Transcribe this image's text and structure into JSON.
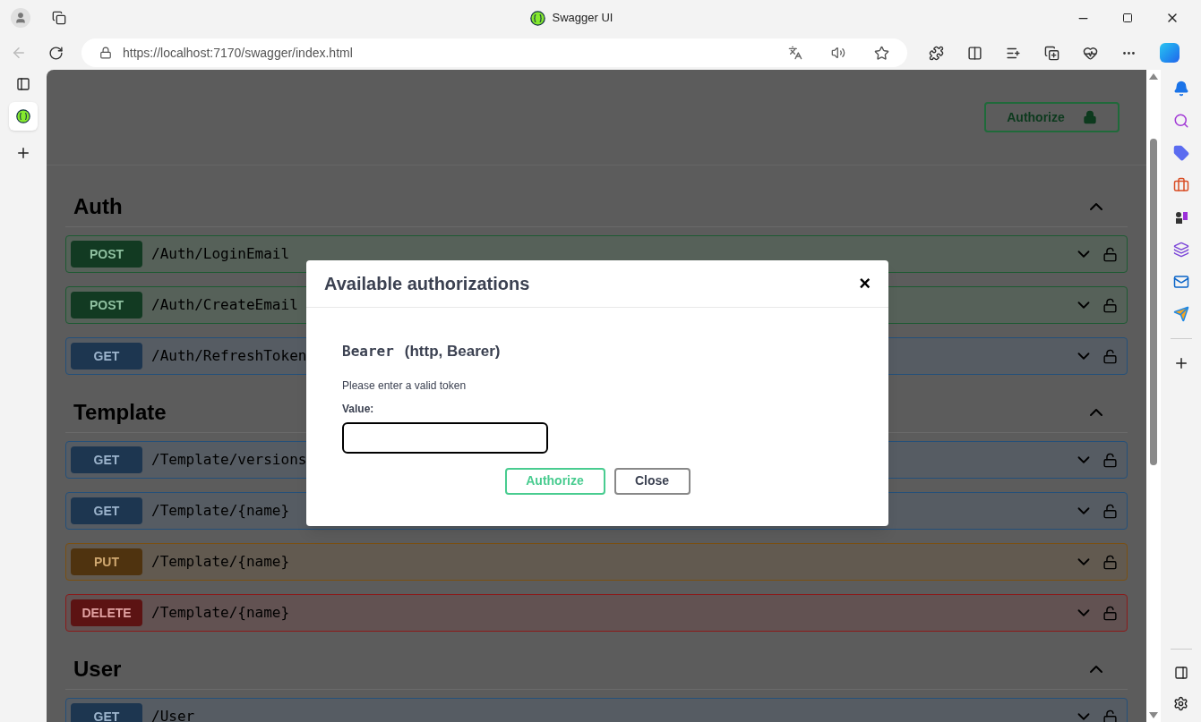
{
  "browser": {
    "tab_title": "Swagger UI",
    "url": "https://localhost:7170/swagger/index.html"
  },
  "page": {
    "authorize_button": "Authorize",
    "sections": [
      {
        "name": "Auth",
        "expanded": true,
        "operations": [
          {
            "kind": "post",
            "method": "POST",
            "path": "/Auth/LoginEmail"
          },
          {
            "kind": "post",
            "method": "POST",
            "path": "/Auth/CreateEmail"
          },
          {
            "kind": "get",
            "method": "GET",
            "path": "/Auth/RefreshToken"
          }
        ]
      },
      {
        "name": "Template",
        "expanded": true,
        "operations": [
          {
            "kind": "get",
            "method": "GET",
            "path": "/Template/versions"
          },
          {
            "kind": "get",
            "method": "GET",
            "path": "/Template/{name}"
          },
          {
            "kind": "put",
            "method": "PUT",
            "path": "/Template/{name}"
          },
          {
            "kind": "delete",
            "method": "DELETE",
            "path": "/Template/{name}"
          }
        ]
      },
      {
        "name": "User",
        "expanded": true,
        "operations": [
          {
            "kind": "get",
            "method": "GET",
            "path": "/User"
          }
        ]
      }
    ]
  },
  "modal": {
    "title": "Available authorizations",
    "close": "×",
    "scheme_name": "Bearer",
    "scheme_info": "(http, Bearer)",
    "description": "Please enter a valid token",
    "value_label": "Value:",
    "buttons": [
      {
        "kind": "authorize",
        "label": "Authorize"
      },
      {
        "kind": "close",
        "label": "Close"
      }
    ]
  }
}
